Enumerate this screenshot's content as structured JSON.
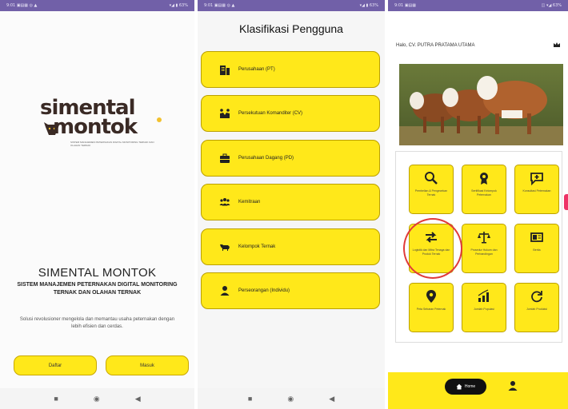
{
  "screen1": {
    "status_left": "9:01 ▣▤▦ ◎ ▲",
    "status_right": "▾◢ ▮ 63%",
    "logo": {
      "line1": "simental",
      "line2": "montok",
      "tagline": "SISTEM MANAJEMEN PETERNAKAN DIGITAL MONITORING TERNAK DAN OLAHAN TERNAK"
    },
    "title": "SIMENTAL MONTOK",
    "subtitle": "SISTEM MANAJEMEN PETERNAKAN DIGITAL MONITORING TERNAK DAN OLAHAN TERNAK",
    "description": "Solusi revolusioner mengelola dan memantau usaha peternakan dengan lebih efisien dan cerdas.",
    "buttons": {
      "register": "Daftar",
      "login": "Masuk"
    }
  },
  "screen2": {
    "status_left": "9:01 ▣▤▦ ◎ ▲",
    "status_right": "▾◢ ▮ 63%",
    "title": "Klasifikasi Pengguna",
    "options": [
      {
        "label": "Perusahaan (PT)",
        "icon": "building-icon"
      },
      {
        "label": "Persekutuan Komanditer (CV)",
        "icon": "handshake-icon"
      },
      {
        "label": "Perusahaan Dagang (PD)",
        "icon": "briefcase-icon"
      },
      {
        "label": "Kemitraan",
        "icon": "group-icon"
      },
      {
        "label": "Kelompok Ternak",
        "icon": "cow-icon"
      },
      {
        "label": "Perseorangan (Individu)",
        "icon": "person-icon"
      }
    ]
  },
  "screen3": {
    "status_left": "9:01 ▣▤▦",
    "status_right": "◫ ▾◢ 63%",
    "greeting": "Halo, CV. PUTRA PRATAMA UTAMA",
    "tiles": [
      {
        "label": "Pembelian & Pengecekan Ternak",
        "icon": "search-icon"
      },
      {
        "label": "Sertifikasi Kelompok Peternakan",
        "icon": "award-icon"
      },
      {
        "label": "Konsultasi Peternakan",
        "icon": "chat-plus-icon"
      },
      {
        "label": "Logistik dan Mitra Tenaga dan Produk Ternak",
        "icon": "swap-arrows-icon"
      },
      {
        "label": "Prosedur Hukum dan Perbandingan",
        "icon": "scale-icon"
      },
      {
        "label": "Berita",
        "icon": "news-icon"
      },
      {
        "label": "Peta Sebaran Peternak",
        "icon": "map-pin-icon"
      },
      {
        "label": "Jumlah Populasi",
        "icon": "bar-chart-icon"
      },
      {
        "label": "Jumlah Produksi",
        "icon": "refresh-icon"
      }
    ],
    "nav": {
      "home": "Home"
    }
  },
  "colors": {
    "accent_yellow": "#ffe81a",
    "status_bar": "#7160a8",
    "highlight_circle": "#e03a3a"
  }
}
